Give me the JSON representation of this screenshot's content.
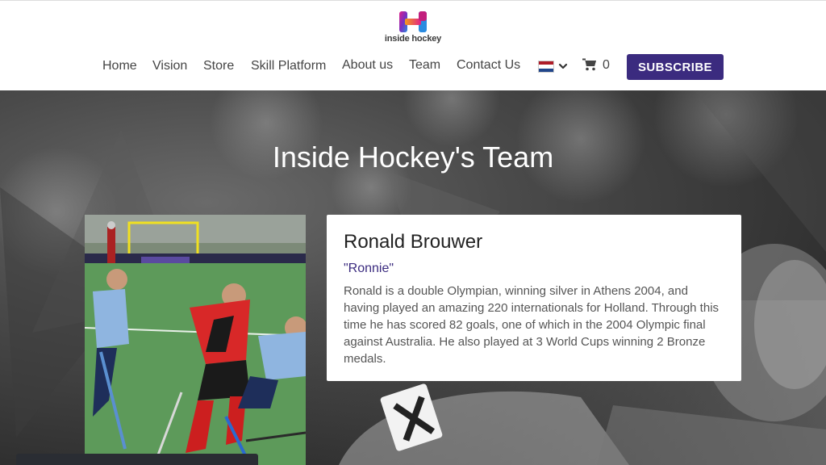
{
  "brand": {
    "name": "inside hockey"
  },
  "nav": {
    "items": [
      {
        "label": "Home"
      },
      {
        "label": "Vision"
      },
      {
        "label": "Store"
      },
      {
        "label": "Skill Platform"
      },
      {
        "label": "About us"
      },
      {
        "label": "Team"
      },
      {
        "label": "Contact Us"
      }
    ],
    "language_flag": "netherlands-flag-icon",
    "cart_count": "0",
    "subscribe_label": "SUBSCRIBE"
  },
  "hero": {
    "title": "Inside Hockey's Team"
  },
  "member": {
    "name": "Ronald Brouwer",
    "nickname": "\"Ronnie\"",
    "bio": "Ronald is a double Olympian, winning silver in Athens 2004, and having played an amazing 220 internationals for Holland. Through this time he has scored 82 goals, one of which in the 2004 Olympic final against Australia. He also played at 3 World Cups winning 2 Bronze medals."
  },
  "colors": {
    "brand_purple": "#3b2b7f",
    "hero_dark": "#2f2f2f",
    "text_dark": "#222222",
    "text_body": "#555555"
  }
}
